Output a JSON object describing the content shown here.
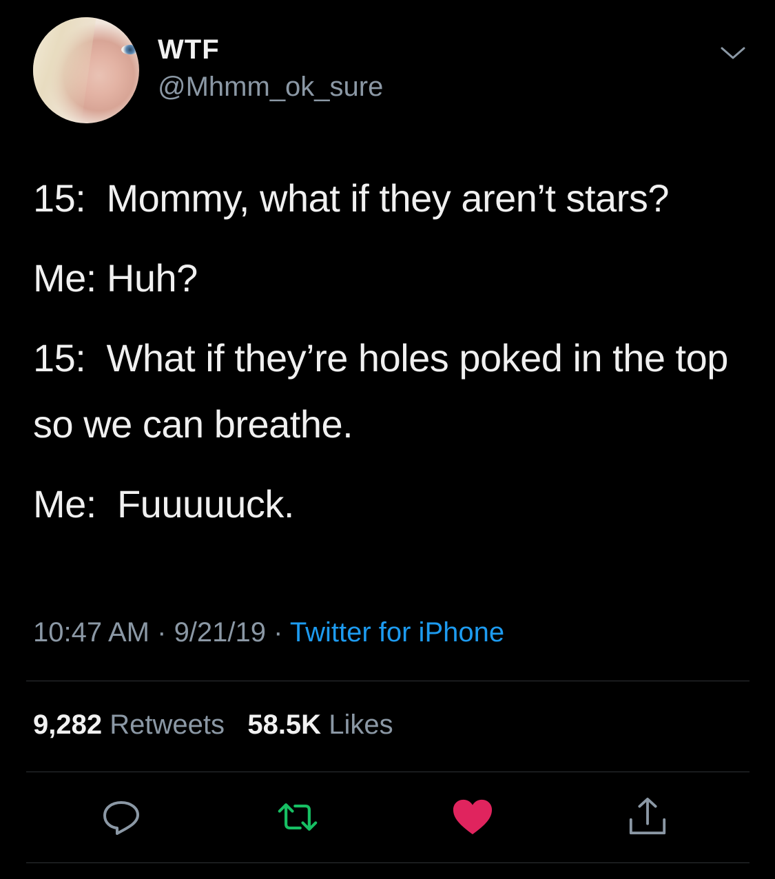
{
  "author": {
    "display_name": "WTF",
    "handle": "@Mhmm_ok_sure"
  },
  "tweet": {
    "lines": [
      "15:  Mommy, what if they aren’t stars?",
      "Me: Huh?",
      "15:  What if they’re holes poked in the top so we can breathe.",
      "Me:  Fuuuuuck."
    ]
  },
  "meta": {
    "time": "10:47 AM",
    "date": "9/21/19",
    "separator": " · ",
    "source": "Twitter for iPhone"
  },
  "stats": {
    "retweets_count": "9,282",
    "retweets_label": "Retweets",
    "likes_count": "58.5K",
    "likes_label": "Likes"
  },
  "actions": {
    "reply_icon": "reply-icon",
    "retweet_icon": "retweet-icon",
    "like_icon": "heart-icon",
    "share_icon": "share-icon"
  },
  "colors": {
    "background": "#000000",
    "link": "#1d9bf0",
    "retweet": "#17bf63",
    "like": "#e0245e",
    "muted": "#8b98a5"
  }
}
